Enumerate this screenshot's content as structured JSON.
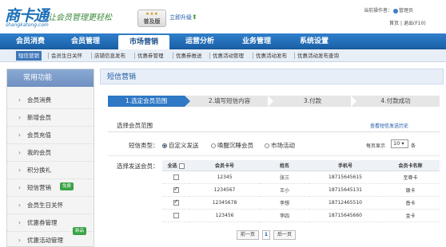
{
  "header": {
    "logo_main": "商卡通",
    "logo_sub": "shangkatong.com",
    "slogan": "让会员管理更轻松",
    "edition_stars": "★★★",
    "edition": "普及版",
    "upgrade": "立即升级",
    "operator_label": "当前操作者：",
    "operator_name": "管理员",
    "home": "首页",
    "logout": "退出(F10)"
  },
  "nav": {
    "items": [
      "会员消费",
      "会员管理",
      "市场营销",
      "运营分析",
      "业务管理",
      "系统设置"
    ],
    "active": "市场营销"
  },
  "subnav": {
    "items": [
      "短信营销",
      "会员生日关怀",
      "店铺信息发布",
      "优惠券管理",
      "优惠券推送",
      "优惠活动管理",
      "优惠活动发布",
      "优惠活动发布查询"
    ]
  },
  "sidebar": {
    "title": "常用功能",
    "items": [
      {
        "label": "会员消费"
      },
      {
        "label": "新增会员"
      },
      {
        "label": "会员充值"
      },
      {
        "label": "我的会员"
      },
      {
        "label": "积分换礼"
      },
      {
        "label": "短信营销",
        "badge": "免费"
      },
      {
        "label": "会员生日关怀"
      },
      {
        "label": "优惠券管理"
      },
      {
        "label": "优惠活动管理",
        "badge": "新品"
      }
    ]
  },
  "main": {
    "title": "短信营销",
    "steps": [
      "1.选定会员范围",
      "2.填写短信内容",
      "3.付款",
      "4.付款成功"
    ],
    "scope_label": "选择会员范围",
    "history_link": "查看短信发送历史",
    "type_label": "短信类型：",
    "types": [
      "自定义发送",
      "唤醒沉睡会员",
      "市场活动"
    ],
    "selected_type": "自定义发送",
    "perpage_label": "每页显示",
    "perpage_value": "10",
    "perpage_unit": "条",
    "select_label": "选择发送会员："
  },
  "table": {
    "headers": [
      "全选",
      "会员卡号",
      "姓名",
      "手机号",
      "会员卡名称"
    ],
    "rows": [
      {
        "checked": false,
        "card": "12345",
        "name": "张三",
        "phone": "18715645615",
        "card_name": "至尊卡"
      },
      {
        "checked": true,
        "card": "1234567",
        "name": "王小",
        "phone": "18715645131",
        "card_name": "银卡"
      },
      {
        "checked": true,
        "card": "12345678",
        "name": "李想",
        "phone": "18712465510",
        "card_name": "普卡"
      },
      {
        "checked": false,
        "card": "123456",
        "name": "李四",
        "phone": "18715645660",
        "card_name": "金卡"
      }
    ]
  },
  "pager": {
    "prev": "前一页",
    "current": "1",
    "next": "后一页"
  },
  "colors": {
    "nav_blue": "#1c62aa",
    "active_step": "#2e78c5",
    "badge_green": "#3aa346",
    "link_blue": "#1a55a6"
  }
}
